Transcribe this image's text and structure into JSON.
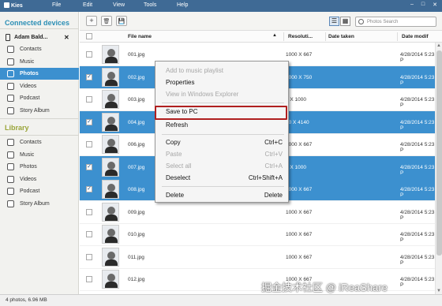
{
  "app": {
    "title": "Kies",
    "menu": [
      "File",
      "Edit",
      "View",
      "Tools",
      "Help"
    ],
    "window_controls": [
      "–",
      "□",
      "✕"
    ]
  },
  "sidebar": {
    "connected_title": "Connected devices",
    "device_name": "Adam Bald...",
    "device_close": "✕",
    "device_items": [
      {
        "label": "Contacts",
        "icon": "contacts-icon"
      },
      {
        "label": "Music",
        "icon": "music-icon"
      },
      {
        "label": "Photos",
        "icon": "photos-icon",
        "selected": true
      },
      {
        "label": "Videos",
        "icon": "videos-icon"
      },
      {
        "label": "Podcast",
        "icon": "podcast-icon"
      },
      {
        "label": "Story Album",
        "icon": "story-album-icon"
      }
    ],
    "library_title": "Library",
    "library_items": [
      {
        "label": "Contacts",
        "icon": "contacts-icon"
      },
      {
        "label": "Music",
        "icon": "music-icon"
      },
      {
        "label": "Photos",
        "icon": "photos-icon"
      },
      {
        "label": "Videos",
        "icon": "videos-icon"
      },
      {
        "label": "Podcast",
        "icon": "podcast-icon"
      },
      {
        "label": "Story Album",
        "icon": "story-album-icon"
      }
    ]
  },
  "toolbar": {
    "add": "+",
    "delete": "🗑",
    "save": "💾",
    "search_placeholder": "Photos Search"
  },
  "table": {
    "headers": {
      "file_name": "File name",
      "resolution": "Resoluti...",
      "date_taken": "Date taken",
      "date_modified": "Date modif"
    },
    "rows": [
      {
        "name": "001.jpg",
        "res": "1000 X 667",
        "date": "4/28/2014 5:23 P",
        "selected": false
      },
      {
        "name": "002.jpg",
        "res": "1000 X 750",
        "date": "4/28/2014 5:23 P",
        "selected": true
      },
      {
        "name": "003.jpg",
        "res": "7 X 1000",
        "date": "4/28/2014 5:23 P",
        "selected": false
      },
      {
        "name": "004.jpg",
        "res": "50 X 4140",
        "date": "4/28/2014 5:23 P",
        "selected": true
      },
      {
        "name": "006.jpg",
        "res": "1000 X 667",
        "date": "4/28/2014 5:23 P",
        "selected": false
      },
      {
        "name": "007.jpg",
        "res": "5 X 1000",
        "date": "4/28/2014 5:23 P",
        "selected": true
      },
      {
        "name": "008.jpg",
        "res": "1000 X 667",
        "date": "4/28/2014 5:23 P",
        "selected": true
      },
      {
        "name": "009.jpg",
        "res": "1000 X 667",
        "date": "4/28/2014 5:23 P",
        "selected": false
      },
      {
        "name": "010.jpg",
        "res": "1000 X 667",
        "date": "4/28/2014 5:23 P",
        "selected": false
      },
      {
        "name": "011.jpg",
        "res": "1000 X 667",
        "date": "4/28/2014 5:23 P",
        "selected": false
      },
      {
        "name": "012.jpg",
        "res": "1000 X 667",
        "date": "4/28/2014 5:23 P",
        "selected": false
      }
    ]
  },
  "context_menu": {
    "items": [
      {
        "label": "Add to music playlist",
        "shortcut": "",
        "disabled": true
      },
      {
        "label": "Properties",
        "shortcut": "",
        "disabled": false
      },
      {
        "label": "View in Windows Explorer",
        "shortcut": "",
        "disabled": true
      },
      {
        "label": "Save to PC",
        "shortcut": "",
        "disabled": false
      },
      {
        "label": "Refresh",
        "shortcut": "",
        "disabled": false
      },
      {
        "label": "Copy",
        "shortcut": "Ctrl+C",
        "disabled": false
      },
      {
        "label": "Paste",
        "shortcut": "Ctrl+V",
        "disabled": true
      },
      {
        "label": "Select all",
        "shortcut": "Ctrl+A",
        "disabled": true
      },
      {
        "label": "Deselect",
        "shortcut": "Ctrl+Shift+A",
        "disabled": false
      },
      {
        "label": "Delete",
        "shortcut": "Delete",
        "disabled": false
      }
    ]
  },
  "status": {
    "text": "4 photos, 6.96 MB"
  },
  "watermark": "掘金技术社区 @ iReaShare",
  "colors": {
    "accent": "#3c90cf",
    "titlebar": "#3f6a95",
    "highlight_box": "#b01f1f",
    "section_title": "#2c8fb5"
  }
}
